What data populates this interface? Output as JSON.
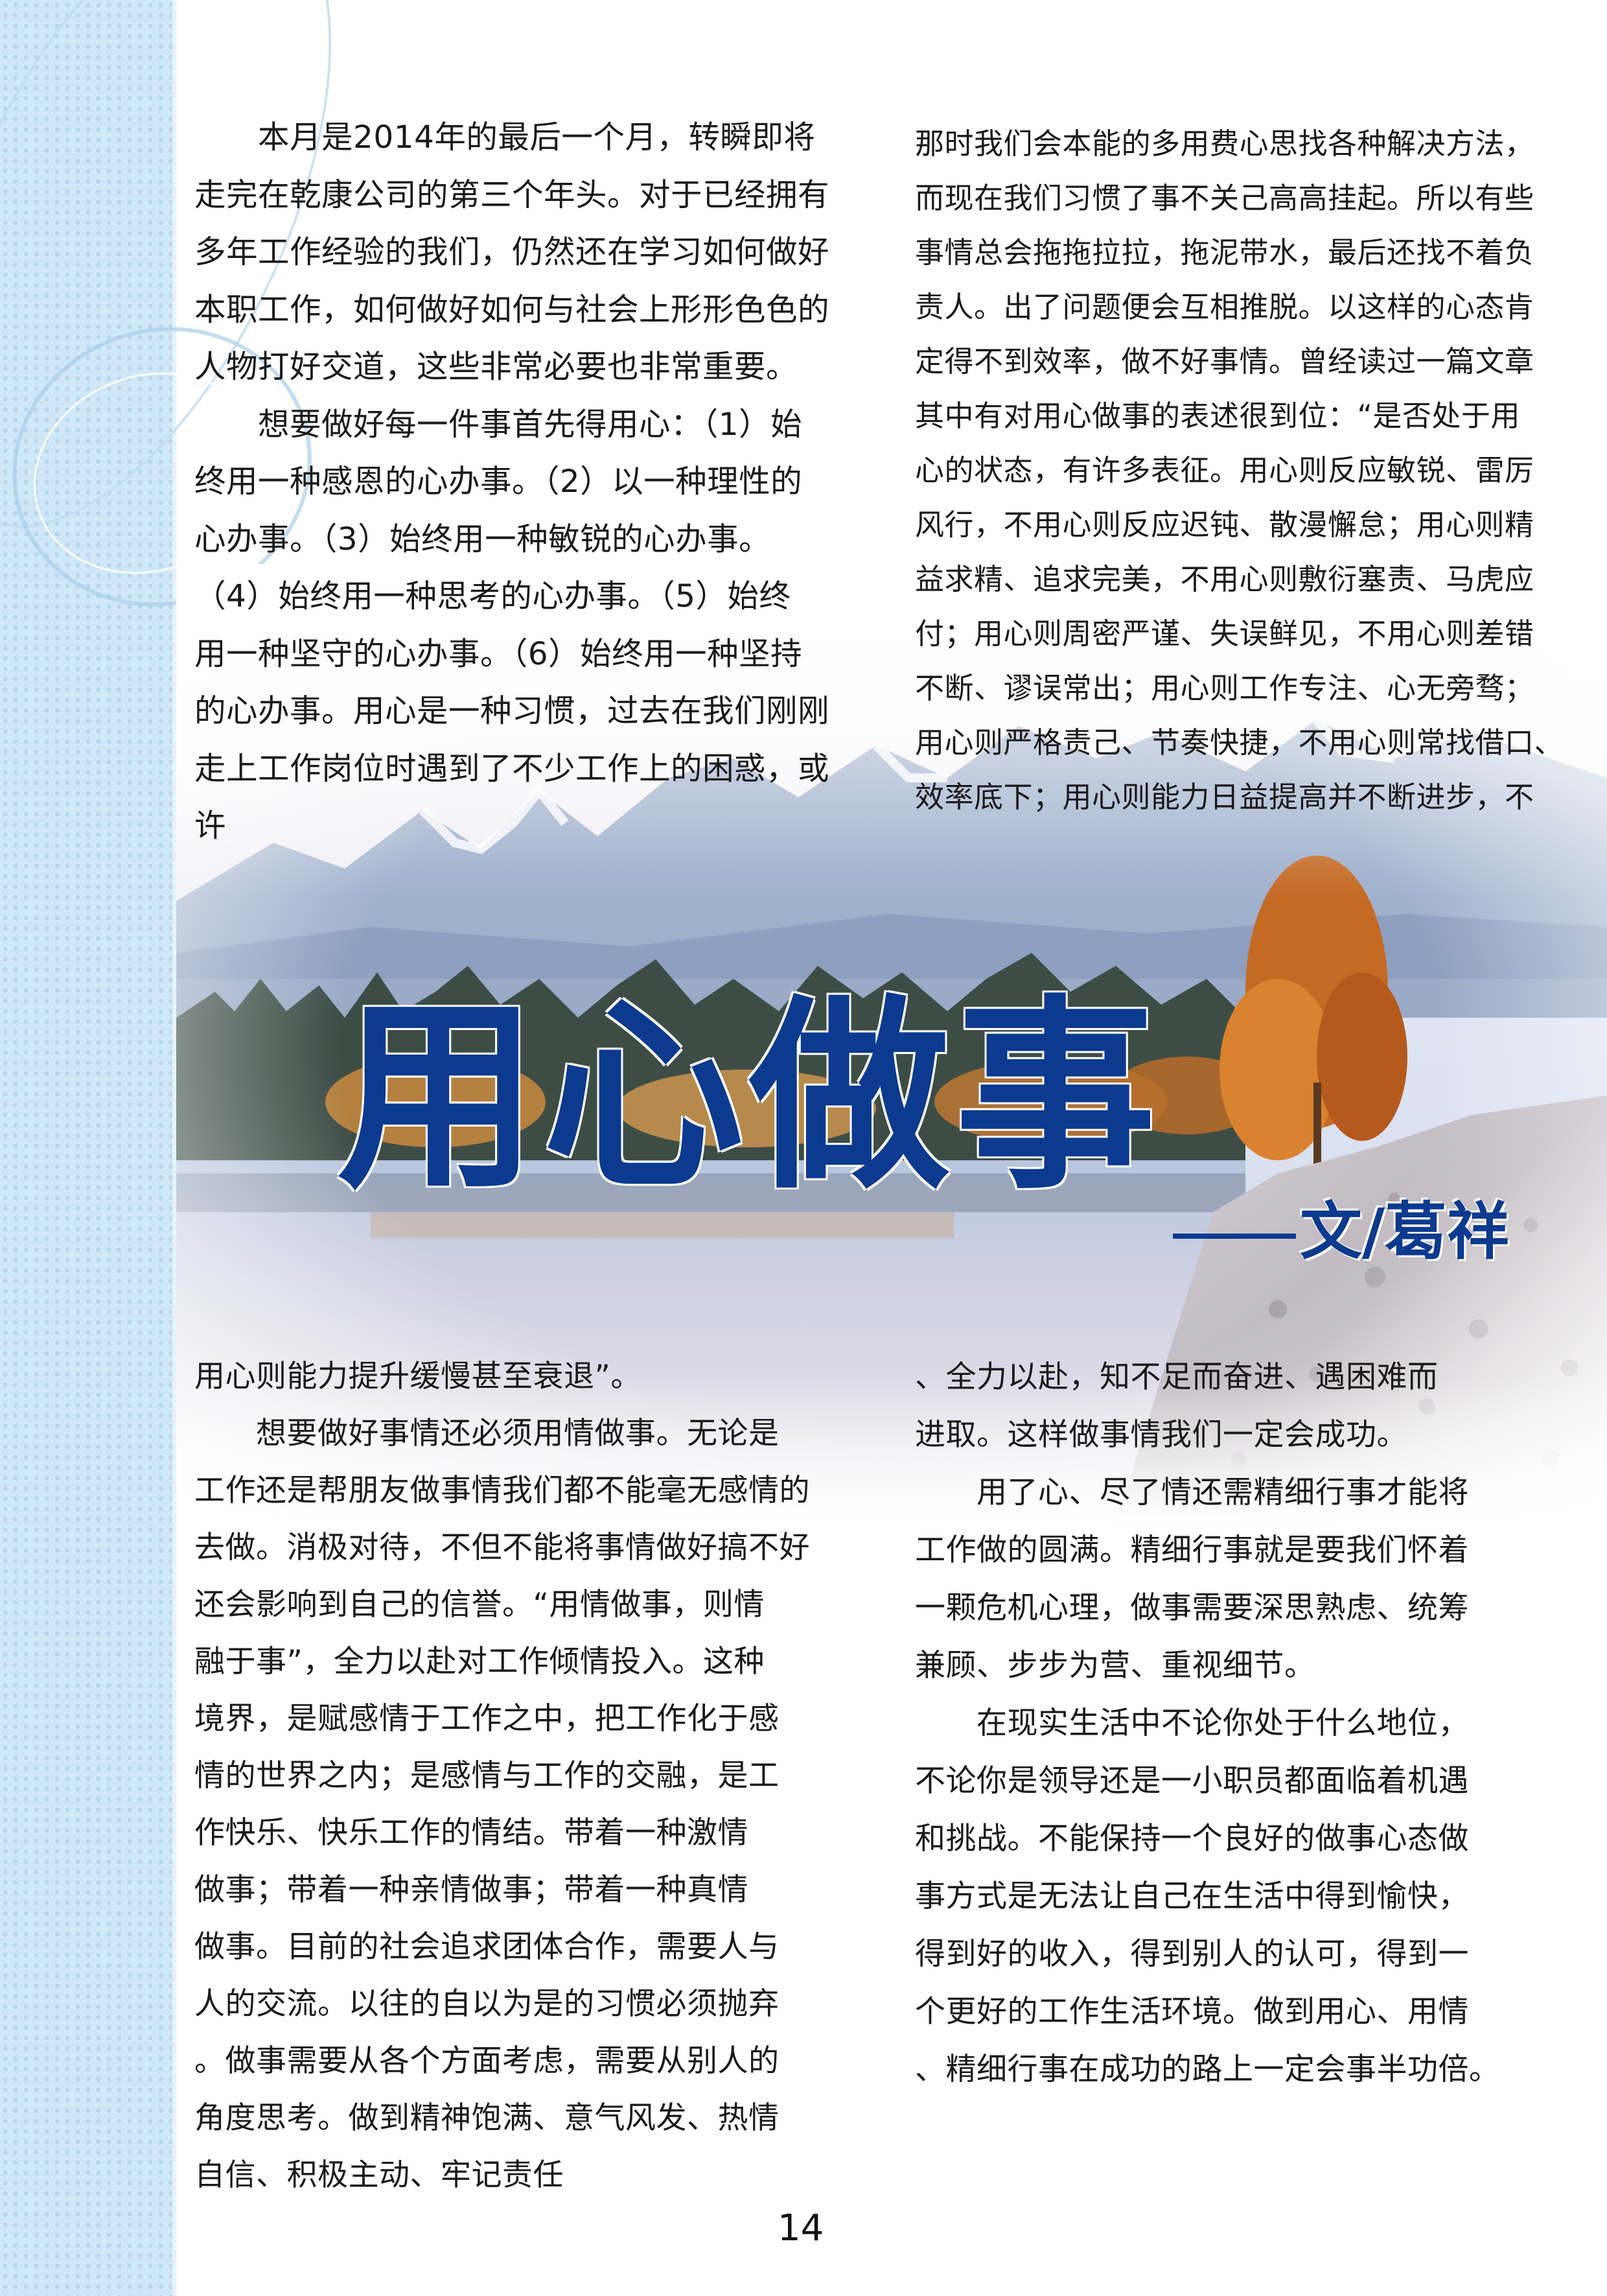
{
  "article": {
    "title": "用心做事",
    "byline": "文/葛祥",
    "left_top_lines": [
      "　　本月是2014年的最后一个月，转瞬即将",
      "走完在乾康公司的第三个年头。对于已经拥有",
      "多年工作经验的我们，仍然还在学习如何做好",
      "本职工作，如何做好如何与社会上形形色色的",
      "人物打好交道，这些非常必要也非常重要。",
      "　　想要做好每一件事首先得用心：（1）始",
      "终用一种感恩的心办事。（2）以一种理性的",
      "心办事。（3）始终用一种敏锐的心办事。",
      "（4）始终用一种思考的心办事。（5）始终",
      "用一种坚守的心办事。（6）始终用一种坚持",
      "的心办事。用心是一种习惯，过去在我们刚刚",
      "走上工作岗位时遇到了不少工作上的困惑，或",
      "许"
    ],
    "right_top_lines": [
      "那时我们会本能的多用费心思找各种解决方法，",
      "而现在我们习惯了事不关己高高挂起。所以有些",
      "事情总会拖拖拉拉，拖泥带水，最后还找不着负",
      "责人。出了问题便会互相推脱。以这样的心态肯",
      "定得不到效率，做不好事情。曾经读过一篇文章",
      "其中有对用心做事的表述很到位：“是否处于用",
      "心的状态，有许多表征。用心则反应敏锐、雷厉",
      "风行，不用心则反应迟钝、散漫懈怠；用心则精",
      "益求精、追求完美，不用心则敷衍塞责、马虎应",
      "付；用心则周密严谨、失误鲜见，不用心则差错",
      "不断、谬误常出；用心则工作专注、心无旁骛；",
      "用心则严格责己、节奏快捷，不用心则常找借口、",
      "效率底下；用心则能力日益提高并不断进步，不"
    ],
    "left_bottom_lines": [
      "用心则能力提升缓慢甚至衰退”。",
      "　　想要做好事情还必须用情做事。无论是",
      "工作还是帮朋友做事情我们都不能毫无感情的",
      "去做。消极对待，不但不能将事情做好搞不好",
      "还会影响到自己的信誉。“用情做事，则情",
      "融于事”，全力以赴对工作倾情投入。这种",
      "境界，是赋感情于工作之中，把工作化于感",
      "情的世界之内；是感情与工作的交融，是工",
      "作快乐、快乐工作的情结。带着一种激情",
      "做事；带着一种亲情做事；带着一种真情",
      "做事。目前的社会追求团体合作，需要人与",
      "人的交流。以往的自以为是的习惯必须抛弃",
      "。做事需要从各个方面考虑，需要从别人的",
      "角度思考。做到精神饱满、意气风发、热情",
      "自信、积极主动、牢记责任"
    ],
    "right_bottom_lines": [
      "、全力以赴，知不足而奋进、遇困难而",
      "进取。这样做事情我们一定会成功。",
      "　　用了心、尽了情还需精细行事才能将",
      "工作做的圆满。精细行事就是要我们怀着",
      "一颗危机心理，做事需要深思熟虑、统筹",
      "兼顾、步步为营、重视细节。",
      "　　在现实生活中不论你处于什么地位，",
      "不论你是领导还是一小职员都面临着机遇",
      "和挑战。不能保持一个良好的做事心态做",
      "事方式是无法让自己在生活中得到愉快，",
      "得到好的收入，得到别人的认可，得到一",
      "个更好的工作生活环境。做到用心、用情",
      "、精细行事在成功的路上一定会事半功倍。"
    ]
  },
  "page": {
    "number": "14"
  },
  "colors": {
    "title": "#0b3a8f",
    "strip": "#cfe7f7"
  }
}
